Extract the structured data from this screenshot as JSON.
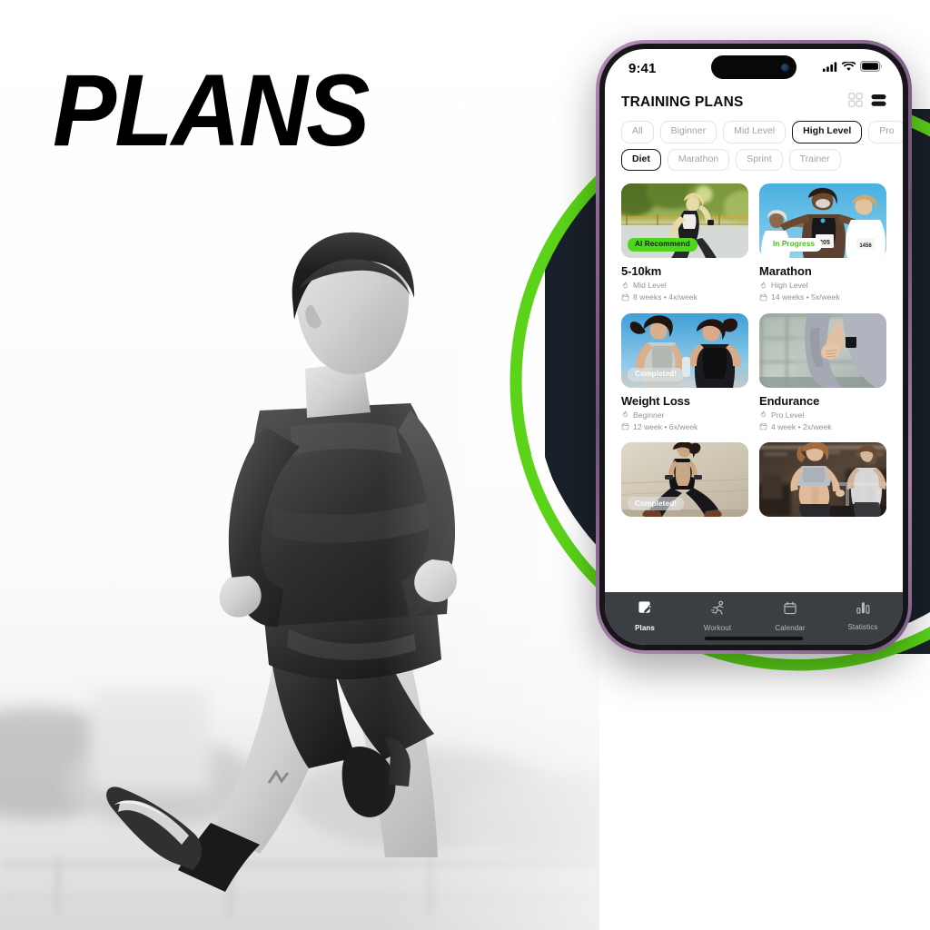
{
  "poster": {
    "headline": "PLANS",
    "accent_green": "#5BD318",
    "dark_shape": "#1A2029",
    "frame_purple": "#8E6D95",
    "background_photo": "black-and-white photo of a male runner mid-stride"
  },
  "phone": {
    "status_bar": {
      "time": "9:41",
      "icons": [
        "cellular-signal-icon",
        "wifi-icon",
        "battery-icon"
      ]
    },
    "header": {
      "title": "TRAINING PLANS",
      "view_toggles": [
        {
          "name": "grid-view-icon",
          "active": false
        },
        {
          "name": "list-view-icon",
          "active": true
        }
      ]
    },
    "filter_chips": {
      "row1": [
        {
          "label": "All",
          "active": false
        },
        {
          "label": "Biginner",
          "active": false
        },
        {
          "label": "Mid Level",
          "active": false
        },
        {
          "label": "High Level",
          "active": true
        },
        {
          "label": "Pro",
          "active": false,
          "clipped": true
        }
      ],
      "row2": [
        {
          "label": "Diet",
          "active": true
        },
        {
          "label": "Marathon",
          "active": false
        },
        {
          "label": "Sprint",
          "active": false
        },
        {
          "label": "Trainer",
          "active": false
        }
      ]
    },
    "plans": [
      {
        "title": "5-10km",
        "level": "Mid Level",
        "schedule": "8 weeks • 4x/week",
        "badge": {
          "text": "AI Recommend",
          "style": "green"
        },
        "image": "woman running on a path with trees"
      },
      {
        "title": "Marathon",
        "level": "High Level",
        "schedule": "14 weeks • 5x/week",
        "badge": {
          "text": "In Progress",
          "style": "white"
        },
        "image": "three race runners celebrating with bib numbers 205 and 1456"
      },
      {
        "title": "Weight Loss",
        "level": "Beginner",
        "schedule": "12 week • 6x/week",
        "badge": {
          "text": "Completed!",
          "style": "glass"
        },
        "image": "two women jogging together against a blue sky"
      },
      {
        "title": "Endurance",
        "level": "Pro Level",
        "schedule": "4 week • 2x/week",
        "badge": null,
        "image": "close-up of runner resting hands on knees on a bridge"
      },
      {
        "title": "",
        "level": "",
        "schedule": "",
        "badge": {
          "text": "Completed!",
          "style": "glass"
        },
        "image": "woman lunging with dumbbells against a beige wall"
      },
      {
        "title": "",
        "level": "",
        "schedule": "",
        "badge": null,
        "image": "woman on a treadmill in a gym"
      }
    ],
    "tabbar": [
      {
        "label": "Plans",
        "icon": "plans-icon",
        "active": true
      },
      {
        "label": "Workout",
        "icon": "running-person-icon",
        "active": false
      },
      {
        "label": "Calendar",
        "icon": "calendar-icon",
        "active": false
      },
      {
        "label": "Statistics",
        "icon": "bar-chart-icon",
        "active": false
      }
    ]
  }
}
